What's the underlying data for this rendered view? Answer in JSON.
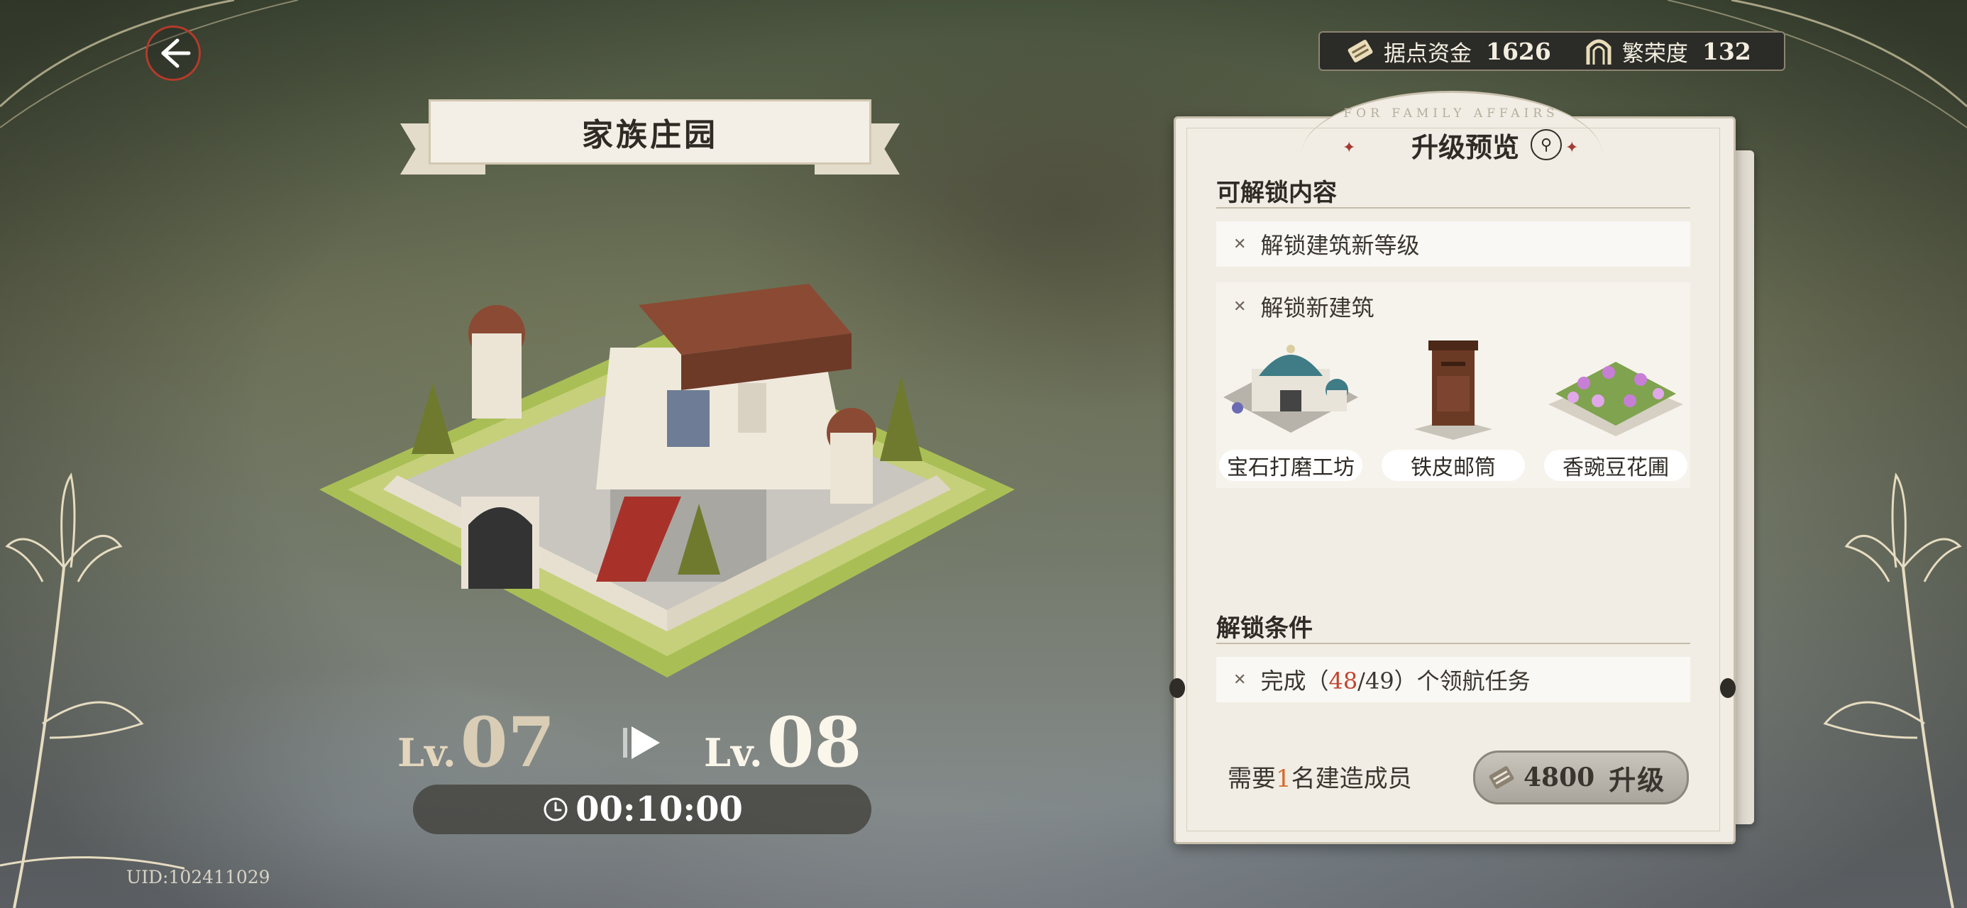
{
  "header": {
    "back_label": "",
    "resources": [
      {
        "label": "据点资金",
        "value": "1626",
        "icon": "scroll-icon"
      },
      {
        "label": "繁荣度",
        "value": "132",
        "icon": "arch-icon"
      }
    ]
  },
  "building": {
    "title": "家族庄园",
    "current_level_prefix": "Lv.",
    "current_level": "07",
    "next_level_prefix": "Lv.",
    "next_level": "08",
    "timer": "00:10:00"
  },
  "uid": "UID:102411029",
  "card": {
    "arch_text": "FOR FAMILY AFFAIRS",
    "title": "升级预览",
    "unlock_section_title": "可解锁内容",
    "unlock_items": [
      {
        "text": "解锁建筑新等级"
      },
      {
        "text": "解锁新建筑"
      }
    ],
    "new_buildings": [
      {
        "name": "宝石打磨工坊"
      },
      {
        "name": "铁皮邮筒"
      },
      {
        "name": "香豌豆花圃"
      }
    ],
    "condition_section_title": "解锁条件",
    "condition": {
      "prefix": "完成（",
      "current": "48",
      "separator": "/",
      "total": "49",
      "suffix": "）个领航任务"
    },
    "builder_need": {
      "prefix": "需要",
      "count": "1",
      "suffix": "名建造成员"
    },
    "upgrade": {
      "cost": "4800",
      "label": "升级"
    }
  },
  "colors": {
    "accent_red": "#c2452f",
    "builder_orange": "#d56b2c",
    "card_bg": "#f1ede4",
    "gold": "#d6b450"
  }
}
